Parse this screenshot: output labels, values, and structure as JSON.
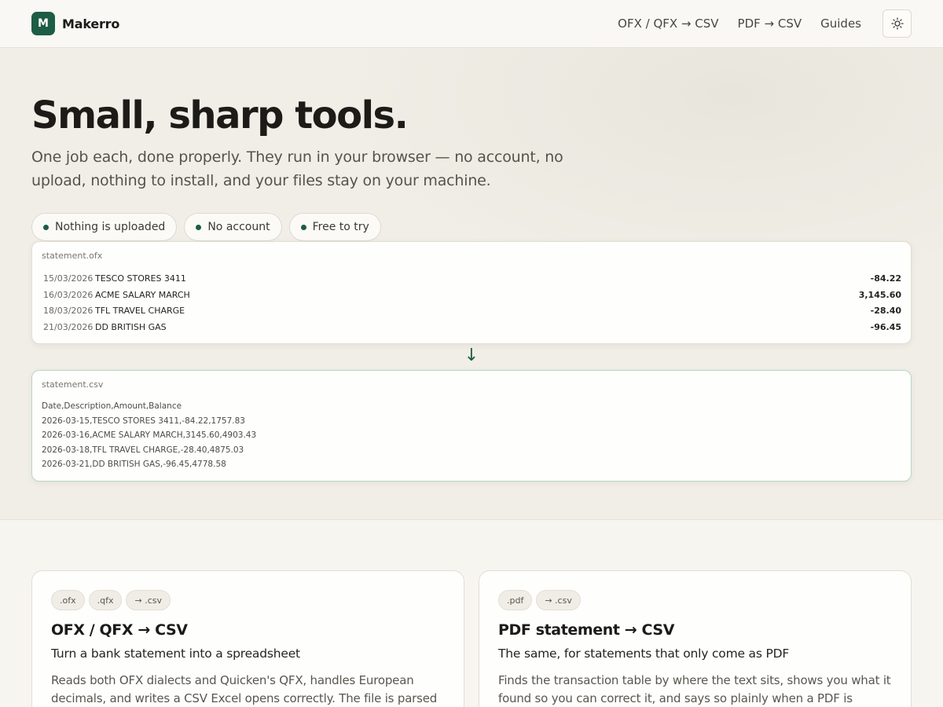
{
  "brand": {
    "mark": "M",
    "name": "Makerro"
  },
  "nav": {
    "items": [
      "OFX / QFX → CSV",
      "PDF → CSV",
      "Guides"
    ],
    "theme_icon": "sun-icon"
  },
  "hero": {
    "title": "Small, sharp tools.",
    "subtitle": "One job each, done properly. They run in your browser — no account, no upload, nothing to install, and your files stay on your machine.",
    "pills": [
      "Nothing is uploaded",
      "No account",
      "Free to try"
    ]
  },
  "ofx": {
    "filename": "statement.ofx",
    "rows": [
      {
        "date": "15/03/2026",
        "desc": "TESCO STORES 3411",
        "amount": "-84.22"
      },
      {
        "date": "16/03/2026",
        "desc": "ACME SALARY MARCH",
        "amount": "3,145.60"
      },
      {
        "date": "18/03/2026",
        "desc": "TFL TRAVEL CHARGE",
        "amount": "-28.40"
      },
      {
        "date": "21/03/2026",
        "desc": "DD BRITISH GAS",
        "amount": "-96.45"
      }
    ]
  },
  "arrow": "↓",
  "csv": {
    "filename": "statement.csv",
    "lines": [
      "Date,Description,Amount,Balance",
      "2026-03-15,TESCO STORES 3411,-84.22,1757.83",
      "2026-03-16,ACME SALARY MARCH,3145.60,4903.43",
      "2026-03-18,TFL TRAVEL CHARGE,-28.40,4875.03",
      "2026-03-21,DD BRITISH GAS,-96.45,4778.58"
    ]
  },
  "tools": [
    {
      "tags": [
        ".ofx",
        ".qfx",
        "→ .csv"
      ],
      "title": "OFX / QFX → CSV",
      "subtitle": "Turn a bank statement into a spreadsheet",
      "body": "Reads both OFX dialects and Quicken's QFX, handles European decimals, and writes a CSV Excel opens correctly. The file is parsed on"
    },
    {
      "tags": [
        ".pdf",
        "→ .csv"
      ],
      "title": "PDF statement → CSV",
      "subtitle": "The same, for statements that only come as PDF",
      "body": "Finds the transaction table by where the text sits, shows you what it found so you can correct it, and says so plainly when a PDF is scanned."
    }
  ],
  "colors": {
    "accent": "#1d5c45",
    "background": "#f7f5f0"
  }
}
